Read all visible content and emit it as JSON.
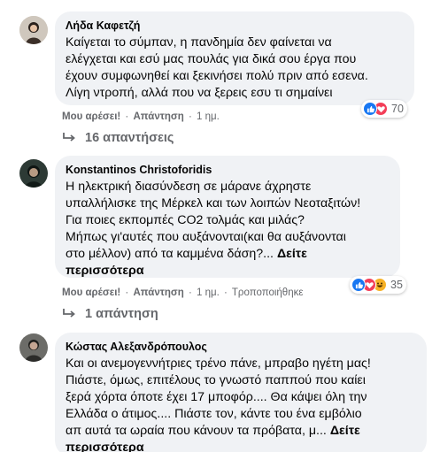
{
  "comments": [
    {
      "author": "Λήδα Καφετζή",
      "lines": [
        "Καίγεται το σύμπαν, η πανδημία δεν φαίνεται να",
        "ελέγχεται και εσύ μας πουλάς για δικά σου έργα που",
        "έχουν συμφωνηθεί και ξεκινήσει πολύ πριν από εσενα.",
        "Λίγη ντροπή, αλλά που να ξερεις εσυ τι σημαίνει"
      ],
      "like": "Μου αρέσει!",
      "reply": "Απάντηση",
      "time": "1 ημ.",
      "reaction_count": "70",
      "replies": "16 απαντήσεις"
    },
    {
      "author": "Konstantinos Christoforidis",
      "lines": [
        "Η ηλεκτρική διασύνδεση σε μάρανε άχρηστε",
        "υπαλλήλισκε της Μέρκελ και των λοιπών Νεοταξιτών!",
        "Για ποιες εκπομπές CO2 τολμάς και μιλάς?",
        "Μήπως γι'αυτές που αυξάνονται(και θα αυξάνονται",
        "στο μέλλον) από τα καμμένα δάση?..."
      ],
      "see_more": "Δείτε",
      "see_more_2": "περισσότερα",
      "like": "Μου αρέσει!",
      "reply": "Απάντηση",
      "time": "1 ημ.",
      "edited": "Τροποποιήθηκε",
      "reaction_count": "35",
      "replies": "1 απάντηση"
    },
    {
      "author": "Κώστας Αλεξανδρόπουλος",
      "lines": [
        "Και οι ανεμογεννήτριες τρένο πάνε, μπραβο ηγέτη μας!",
        "Πιάστε, όμως, επιτέλους το γνωστό παππού που καίει",
        "ξερά χόρτα όποτε έχει 17 μποφόρ.... Θα κάψει όλη την",
        "Ελλάδα ο άτιμος.... Πιάστε τον, κάντε του ένα εμβόλιο",
        "απ αυτά τα ωραία που κάνουν τα πρόβατα, μ..."
      ],
      "see_more": "Δείτε",
      "see_more_2": "περισσότερα"
    }
  ],
  "colors": {
    "bubble": "#f0f2f5",
    "meta": "#65676b",
    "like_blue": "#1877f2",
    "love_red": "#f33e58",
    "haha_yellow": "#f7b125"
  }
}
